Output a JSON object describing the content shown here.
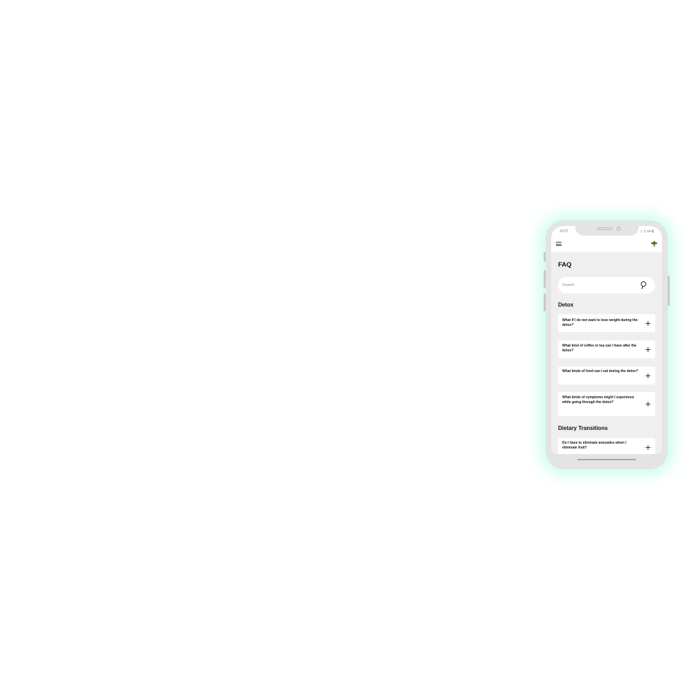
{
  "status_bar": {
    "time": "10:07",
    "indicators": "◇ .∥ 35%▎"
  },
  "header": {
    "menu_icon": "hamburger-menu-icon",
    "avatar_icon": "plant-avatar-icon"
  },
  "page": {
    "title": "FAQ"
  },
  "search": {
    "placeholder": "Search",
    "value": "",
    "icon": "search-icon"
  },
  "sections": [
    {
      "title": "Detox",
      "questions": [
        "What if I do not want to lose weight during the detox?",
        "What kind of coffee or tea can I have after the detox?",
        "What kinds of food can I eat during the detox?",
        "What kinds of symptoms might I experience while going through the detox?"
      ]
    },
    {
      "title": "Dietary Transitions",
      "questions": [
        "Do I have to eliminate avocados when I eliminate fruit?"
      ]
    }
  ],
  "colors": {
    "glow": "#78FAD2",
    "frame": "#E4E4E4",
    "screen_bg": "#EFEFEF",
    "card_bg": "#FFFFFF",
    "text": "#111111"
  }
}
